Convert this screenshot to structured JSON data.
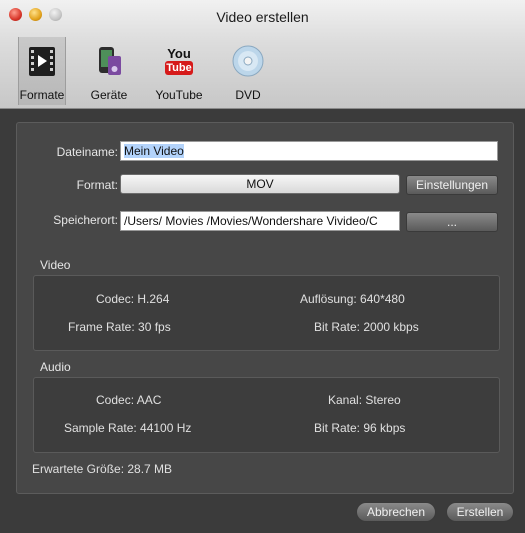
{
  "window": {
    "title": "Video erstellen"
  },
  "toolbar": {
    "items": [
      {
        "label": "Formate",
        "icon": "film-icon"
      },
      {
        "label": "Geräte",
        "icon": "device-icon"
      },
      {
        "label": "YouTube",
        "icon": "youtube-icon",
        "icon_text_top": "You",
        "icon_text_bottom": "Tube"
      },
      {
        "label": "DVD",
        "icon": "dvd-icon"
      }
    ]
  },
  "form": {
    "filename_label": "Dateiname:",
    "filename_value": "Mein Video",
    "format_label": "Format:",
    "format_value": "MOV",
    "settings_button": "Einstellungen",
    "location_label": "Speicherort:",
    "location_value": "/Users/ Movies /Movies/Wondershare Vivideo/C",
    "browse_button": "..."
  },
  "video": {
    "title": "Video",
    "codec": "Codec: H.264",
    "resolution": "Auflösung: 640*480",
    "frame_rate": "Frame Rate: 30 fps",
    "bit_rate": "Bit Rate: 2000 kbps"
  },
  "audio": {
    "title": "Audio",
    "codec": "Codec: AAC",
    "channel": "Kanal: Stereo",
    "sample_rate": "Sample Rate: 44100 Hz",
    "bit_rate": "Bit Rate: 96 kbps"
  },
  "expected_size": "Erwartete Größe: 28.7 MB",
  "buttons": {
    "cancel": "Abbrechen",
    "create": "Erstellen"
  }
}
